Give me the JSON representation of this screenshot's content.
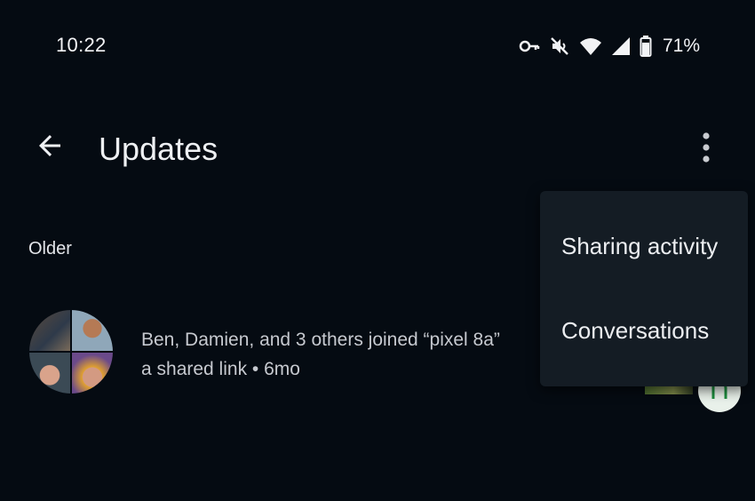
{
  "status_bar": {
    "time": "10:22",
    "battery_percent": "71%",
    "icons": [
      "vpn-key-icon",
      "mute-icon",
      "wifi-icon",
      "signal-icon",
      "battery-icon"
    ]
  },
  "app_bar": {
    "title": "Updates",
    "back_icon": "arrow-back-icon",
    "overflow_icon": "more-vert-icon"
  },
  "section": {
    "header": "Older"
  },
  "update": {
    "line1": "Ben, Damien, and 3 others joined “pixel 8a”",
    "line2": "a shared link • 6mo"
  },
  "menu": {
    "items": [
      {
        "label": "Sharing activity"
      },
      {
        "label": "Conversations"
      }
    ]
  },
  "colors": {
    "background": "#050b12",
    "menu_background": "#141c24",
    "text_primary": "#eef0f3",
    "text_secondary": "#c6c9cf",
    "badge_green": "#1e8e3e"
  }
}
